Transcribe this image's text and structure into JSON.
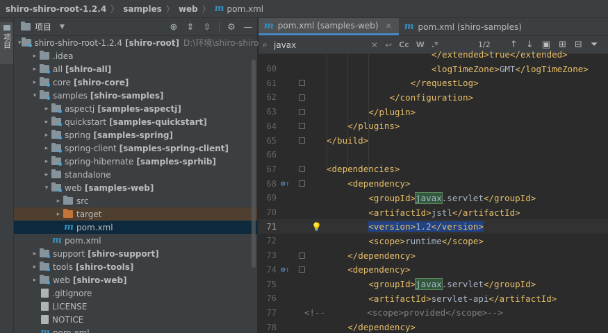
{
  "breadcrumb": {
    "root": "shiro-shiro-root-1.2.4",
    "part2": "samples",
    "part3": "web",
    "file": "pom.xml"
  },
  "left_strip": {
    "label": "项目"
  },
  "project_panel": {
    "title": "项目",
    "tree": [
      {
        "arrow": "▾",
        "icon": "folder-gray",
        "name": "shiro-shiro-root-1.2.4",
        "module": "[shiro-root]",
        "path": "D:\\环境\\shiro-shiro-ro",
        "indent": 0
      },
      {
        "arrow": "▸",
        "icon": "folder-gray",
        "name": ".idea",
        "module": "",
        "indent": 1
      },
      {
        "arrow": "▸",
        "icon": "folder-gray",
        "name": "all",
        "module": "[shiro-all]",
        "indent": 1
      },
      {
        "arrow": "▸",
        "icon": "folder-gray",
        "name": "core",
        "module": "[shiro-core]",
        "indent": 1
      },
      {
        "arrow": "▾",
        "icon": "folder-gray",
        "name": "samples",
        "module": "[shiro-samples]",
        "indent": 1
      },
      {
        "arrow": "▸",
        "icon": "folder-gray",
        "name": "aspectj",
        "module": "[samples-aspectj]",
        "indent": 2
      },
      {
        "arrow": "▸",
        "icon": "folder-gray",
        "name": "quickstart",
        "module": "[samples-quickstart]",
        "indent": 2
      },
      {
        "arrow": "▸",
        "icon": "folder-gray",
        "name": "spring",
        "module": "[samples-spring]",
        "indent": 2
      },
      {
        "arrow": "▸",
        "icon": "folder-gray",
        "name": "spring-client",
        "module": "[samples-spring-client]",
        "indent": 2
      },
      {
        "arrow": "▸",
        "icon": "folder-gray",
        "name": "spring-hibernate",
        "module": "[samples-sprhib]",
        "indent": 2
      },
      {
        "arrow": "▸",
        "icon": "folder-gray",
        "name": "standalone",
        "module": "",
        "indent": 2
      },
      {
        "arrow": "▾",
        "icon": "folder-gray",
        "name": "web",
        "module": "[samples-web]",
        "indent": 2
      },
      {
        "arrow": "▸",
        "icon": "folder-gray",
        "name": "src",
        "module": "",
        "indent": 3
      },
      {
        "arrow": "▸",
        "icon": "folder-orange",
        "name": "target",
        "module": "",
        "indent": 3,
        "sel": "orange"
      },
      {
        "arrow": "",
        "icon": "maven",
        "name": "pom.xml",
        "module": "",
        "indent": 3,
        "sel": "blue"
      },
      {
        "arrow": "",
        "icon": "maven",
        "name": "pom.xml",
        "module": "",
        "indent": 2
      },
      {
        "arrow": "▸",
        "icon": "folder-gray",
        "name": "support",
        "module": "[shiro-support]",
        "indent": 1
      },
      {
        "arrow": "▸",
        "icon": "folder-gray",
        "name": "tools",
        "module": "[shiro-tools]",
        "indent": 1
      },
      {
        "arrow": "▸",
        "icon": "folder-gray",
        "name": "web",
        "module": "[shiro-web]",
        "indent": 1
      },
      {
        "arrow": "",
        "icon": "file",
        "name": ".gitignore",
        "module": "",
        "indent": 1
      },
      {
        "arrow": "",
        "icon": "file",
        "name": "LICENSE",
        "module": "",
        "indent": 1
      },
      {
        "arrow": "",
        "icon": "file",
        "name": "NOTICE",
        "module": "",
        "indent": 1
      },
      {
        "arrow": "",
        "icon": "maven",
        "name": "pom.xml",
        "module": "",
        "indent": 1
      }
    ]
  },
  "editor": {
    "tabs": [
      {
        "label": "pom.xml (samples-web)",
        "active": true
      },
      {
        "label": "pom.xml (shiro-samples)",
        "active": false
      }
    ],
    "find": {
      "value": "javax",
      "count": "1/2",
      "cc": "Cc",
      "w": "W"
    },
    "lines": [
      {
        "n": "",
        "indent": 20,
        "html": "<span class='tag'>&lt;/extended&gt;</span><span class='tag'>true</span><span class='tag'>&lt;/extended&gt;</span>"
      },
      {
        "n": "60",
        "indent": 20,
        "html": "<span class='tag'>&lt;logTimeZone&gt;</span><span class='txt'>GMT</span><span class='tag'>&lt;/logTimeZone&gt;</span>"
      },
      {
        "n": "61",
        "indent": 16,
        "html": "<span class='tag'>&lt;/requestLog&gt;</span>",
        "fold": true
      },
      {
        "n": "62",
        "indent": 12,
        "html": "<span class='tag'>&lt;/configuration&gt;</span>",
        "fold": true
      },
      {
        "n": "63",
        "indent": 8,
        "html": "<span class='tag'>&lt;/plugin&gt;</span>",
        "fold": true
      },
      {
        "n": "64",
        "indent": 4,
        "html": "<span class='tag'>&lt;/plugins&gt;</span>",
        "fold": true
      },
      {
        "n": "65",
        "indent": 0,
        "html": "<span class='tag'>&lt;/build&gt;</span>",
        "fold": true
      },
      {
        "n": "66",
        "indent": 0,
        "html": ""
      },
      {
        "n": "67",
        "indent": 0,
        "html": "<span class='tag'>&lt;dependencies&gt;</span>",
        "fold": true
      },
      {
        "n": "68",
        "indent": 4,
        "html": "<span class='tag'>&lt;dependency&gt;</span>",
        "fold": true,
        "marker": true
      },
      {
        "n": "69",
        "indent": 8,
        "html": "<span class='tag'>&lt;groupId&gt;</span><span class='hl'>javax</span><span class='txt'>.servlet</span><span class='tag'>&lt;/groupId&gt;</span>"
      },
      {
        "n": "70",
        "indent": 8,
        "html": "<span class='tag'>&lt;artifactId&gt;</span><span class='txt'>jstl</span><span class='tag'>&lt;/artifactId&gt;</span>"
      },
      {
        "n": "71",
        "indent": 8,
        "html": "<span class='selbg'><span class='tag'>&lt;version&gt;</span><span class='txt'>1.2</span><span class='tag'>&lt;/version&gt;</span></span>",
        "current": true,
        "bulb": true
      },
      {
        "n": "72",
        "indent": 8,
        "html": "<span class='tag'>&lt;scope&gt;</span><span class='txt'>runtime</span><span class='tag'>&lt;/scope&gt;</span>"
      },
      {
        "n": "73",
        "indent": 4,
        "html": "<span class='tag'>&lt;/dependency&gt;</span>",
        "fold": true
      },
      {
        "n": "74",
        "indent": 4,
        "html": "<span class='tag'>&lt;dependency&gt;</span>",
        "fold": true,
        "marker": true
      },
      {
        "n": "75",
        "indent": 8,
        "html": "<span class='tag'>&lt;groupId&gt;</span><span class='hl'>javax</span><span class='txt'>.servlet</span><span class='tag'>&lt;/groupId&gt;</span>"
      },
      {
        "n": "76",
        "indent": 8,
        "html": "<span class='tag'>&lt;artifactId&gt;</span><span class='txt'>servlet-api</span><span class='tag'>&lt;/artifactId&gt;</span>"
      },
      {
        "n": "77",
        "indent": 0,
        "html": "<span class='cmt'>&lt;!--        &lt;scope&gt;provided&lt;/scope&gt;--&gt;</span>",
        "comment": true
      },
      {
        "n": "78",
        "indent": 4,
        "html": "<span class='tag'>&lt;/dependency&gt;</span>"
      }
    ]
  },
  "colors": {
    "tag": "#e8bf6a",
    "text": "#a9b7c6",
    "selection": "#214283",
    "search_hit": "#32593d",
    "accent": "#4a88c7"
  }
}
